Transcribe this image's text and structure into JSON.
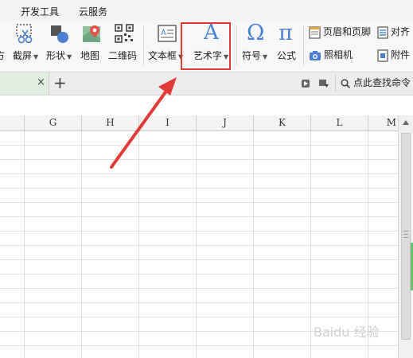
{
  "menu": {
    "developer_tools": "开发工具",
    "cloud_service": "云服务"
  },
  "ribbon": {
    "partial_left": "方",
    "screenshot": "截屏",
    "shapes": "形状",
    "map": "地图",
    "qrcode": "二维码",
    "textbox": "文本框",
    "wordart": "艺术字",
    "wordart_glyph": "A",
    "symbol": "符号",
    "symbol_glyph": "Ω",
    "formula": "公式",
    "formula_glyph": "π",
    "header_footer": "页眉和页脚",
    "camera": "照相机",
    "align_partial": "对齐",
    "attach_partial": "附件"
  },
  "tabbar": {
    "close_glyph": "×",
    "new_tab_glyph": "+",
    "search_placeholder": "点此查找命令"
  },
  "columns": [
    "G",
    "H",
    "I",
    "J",
    "K",
    "L",
    "M"
  ],
  "watermark": "Baidu 经验",
  "colors": {
    "highlight": "#e23a36",
    "arrow": "#e23a36",
    "doc_tab": "#e2f0e4",
    "icon_blue": "#4a7fd4"
  }
}
